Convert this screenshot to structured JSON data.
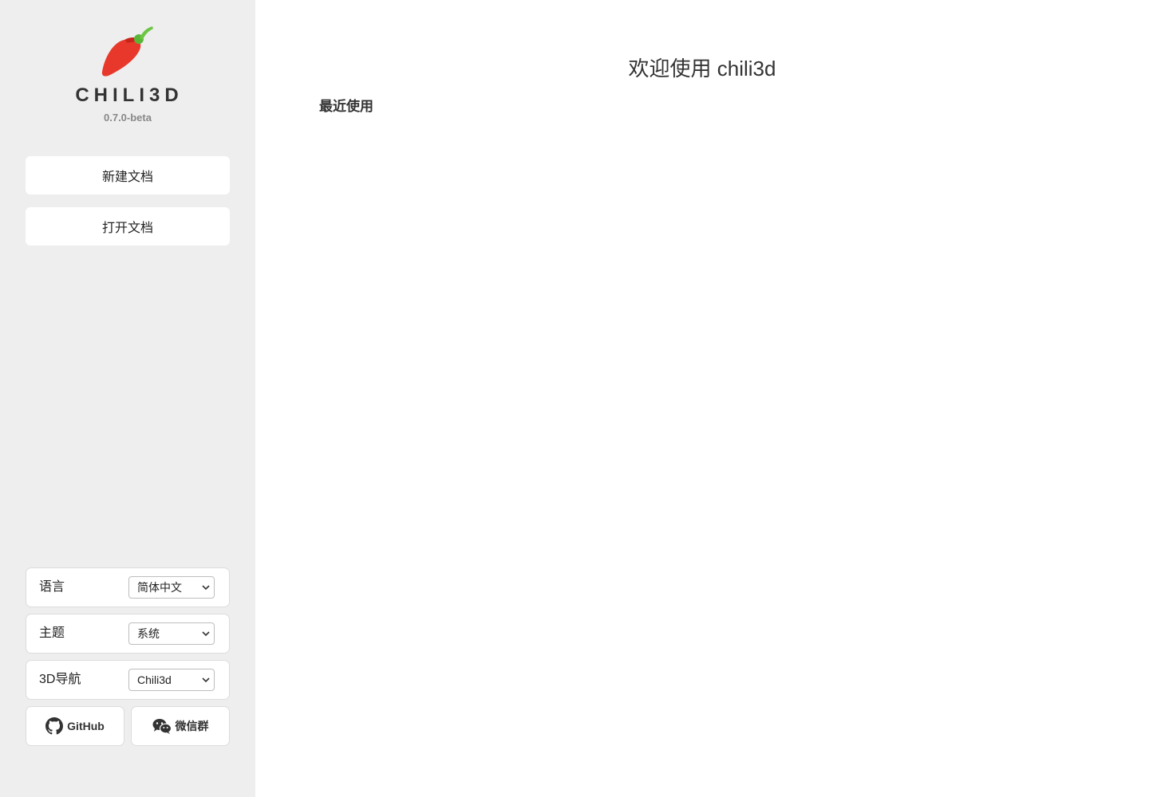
{
  "sidebar": {
    "logo_text": "CHILI3D",
    "version": "0.7.0-beta",
    "new_document": "新建文档",
    "open_document": "打开文档",
    "settings": {
      "language": {
        "label": "语言",
        "value": "简体中文"
      },
      "theme": {
        "label": "主题",
        "value": "系统"
      },
      "navigation": {
        "label": "3D导航",
        "value": "Chili3d"
      }
    },
    "links": {
      "github": {
        "label": "GitHub",
        "icon": "github-icon"
      },
      "wechat": {
        "label": "微信群",
        "icon": "wechat-icon"
      }
    }
  },
  "main": {
    "welcome_title": "欢迎使用 chili3d",
    "recent_heading": "最近使用"
  },
  "colors": {
    "sidebar_bg": "#eeeeee",
    "pepper_red": "#e8382c",
    "pepper_stem": "#6cc644"
  }
}
